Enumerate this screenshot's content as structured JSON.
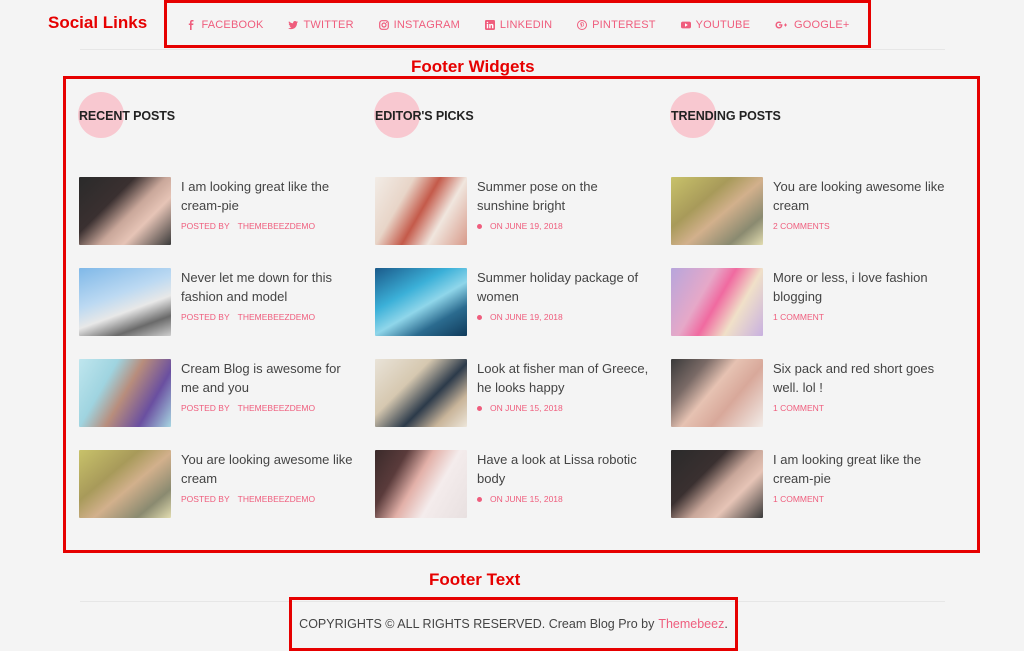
{
  "annotations": {
    "social_links": "Social Links",
    "footer_widgets": "Footer Widgets",
    "footer_text": "Footer Text"
  },
  "social": [
    {
      "label": "FACEBOOK",
      "icon": "facebook-icon"
    },
    {
      "label": "TWITTER",
      "icon": "twitter-icon"
    },
    {
      "label": "INSTAGRAM",
      "icon": "instagram-icon"
    },
    {
      "label": "LINKEDIN",
      "icon": "linkedin-icon"
    },
    {
      "label": "PINTEREST",
      "icon": "pinterest-icon"
    },
    {
      "label": "YOUTUBE",
      "icon": "youtube-icon"
    },
    {
      "label": "GOOGLE+",
      "icon": "google-plus-icon"
    }
  ],
  "columns": [
    {
      "title": "RECENT POSTS",
      "posts": [
        {
          "title": "I am looking great like the cream-pie",
          "meta_prefix": "POSTED BY",
          "meta": "THEMEBEEZDEMO"
        },
        {
          "title": "Never let me down for this fashion and model",
          "meta_prefix": "POSTED BY",
          "meta": "THEMEBEEZDEMO"
        },
        {
          "title": "Cream Blog is awesome for me and you",
          "meta_prefix": "POSTED BY",
          "meta": "THEMEBEEZDEMO"
        },
        {
          "title": "You are looking awesome like cream",
          "meta_prefix": "POSTED BY",
          "meta": "THEMEBEEZDEMO"
        }
      ]
    },
    {
      "title": "EDITOR'S PICKS",
      "posts": [
        {
          "title": "Summer pose on the sunshine bright",
          "meta_prefix": "",
          "meta": "ON JUNE 19, 2018"
        },
        {
          "title": "Summer holiday package of women",
          "meta_prefix": "",
          "meta": "ON JUNE 19, 2018"
        },
        {
          "title": "Look at fisher man of Greece, he looks happy",
          "meta_prefix": "",
          "meta": "ON JUNE 15, 2018"
        },
        {
          "title": "Have a look at Lissa robotic body",
          "meta_prefix": "",
          "meta": "ON JUNE 15, 2018"
        }
      ]
    },
    {
      "title": "TRENDING POSTS",
      "posts": [
        {
          "title": "You are looking awesome like cream",
          "meta_prefix": "",
          "meta": "2 COMMENTS"
        },
        {
          "title": "More or less, i love fashion blogging",
          "meta_prefix": "",
          "meta": "1 COMMENT"
        },
        {
          "title": "Six pack and red short goes well. lol !",
          "meta_prefix": "",
          "meta": "1 COMMENT"
        },
        {
          "title": "I am looking great like the cream-pie",
          "meta_prefix": "",
          "meta": "1 COMMENT"
        }
      ]
    }
  ],
  "footer": {
    "copyright": "COPYRIGHTS © ALL RIGHTS RESERVED. Cream Blog Pro by",
    "link": "Themebeez",
    "suffix": "."
  },
  "colors": {
    "accent": "#ef5d7d",
    "annotation": "#e60000",
    "title_highlight": "#f8c8d0"
  }
}
